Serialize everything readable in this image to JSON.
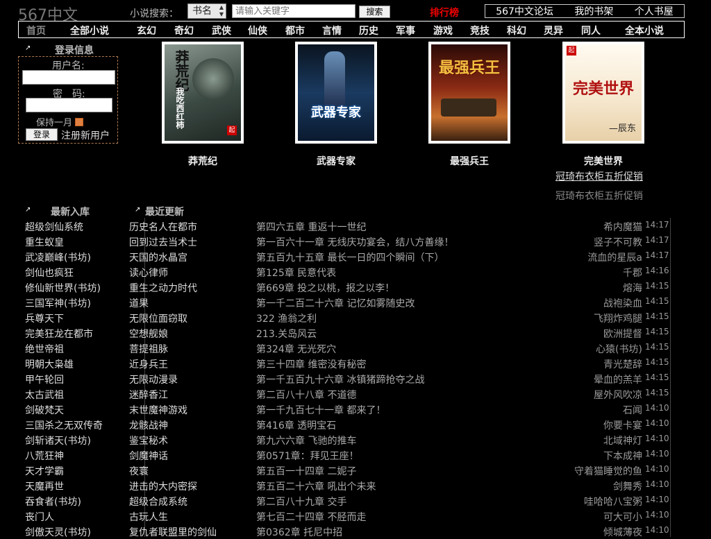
{
  "logo": "567中文",
  "search": {
    "label": "小说搜索：",
    "type": "书名",
    "placeholder": "请输入关键字",
    "button": "搜索"
  },
  "rank_link": "排行榜",
  "top_links": [
    "567中文论坛",
    "我的书架",
    "个人书屋"
  ],
  "nav": [
    "首页",
    "全部小说",
    "玄幻",
    "奇幻",
    "武侠",
    "仙侠",
    "都市",
    "言情",
    "历史",
    "军事",
    "游戏",
    "竞技",
    "科幻",
    "灵异",
    "同人",
    "全本小说"
  ],
  "login": {
    "title": "登录信息",
    "username_label": "用户名:",
    "password_label": "密　码:",
    "remember": "保持一月",
    "login_button": "登录",
    "register": "注册新用户"
  },
  "featured": [
    {
      "title": "莽荒纪",
      "cover_text": "莽荒纪",
      "author_text": "我吃西红柿",
      "colors": [
        "#2d3a34",
        "#6b7a70"
      ]
    },
    {
      "title": "武器专家",
      "cover_text": "武器专家",
      "author_text": "",
      "colors": [
        "#0c2a4a",
        "#3a6ea0"
      ]
    },
    {
      "title": "最强兵王",
      "cover_text": "最强兵王",
      "author_text": "",
      "colors": [
        "#5a1810",
        "#c06a30"
      ]
    },
    {
      "title": "完美世界",
      "cover_text": "完美世界",
      "author_text": "—辰东",
      "colors": [
        "#f5efe0",
        "#e8c8a0"
      ]
    }
  ],
  "promos": [
    "冠琦布衣柜五折促销",
    "冠琦布衣柜五折促销"
  ],
  "sections": {
    "latest": "最新入库",
    "updates": "最近更新"
  },
  "latest_books": [
    "超级剑仙系统",
    "重生蚁皇",
    "武凌巅峰(书坊)",
    "剑仙也疯狂",
    "修仙新世界(书坊)",
    "三国军神(书坊)",
    "兵尊天下",
    "完美狂龙在都市",
    "绝世帝祖",
    "明朝大枭雄",
    "甲午轮回",
    "太古武祖",
    "剑破梵天",
    "三国杀之无双传奇",
    "剑斩诸天(书坊)",
    "八荒狂神",
    "天才学霸",
    "天魔再世",
    "吞食者(书坊)",
    "丧门人",
    "剑傲天灵(书坊)"
  ],
  "updates": [
    {
      "title": "历史名人在都市",
      "chapter": "第四六五章 重返十一世纪",
      "author": "希内魔猫",
      "time": "14:17"
    },
    {
      "title": "回到过去当术士",
      "chapter": "第一百六十一章 无线庆功宴会，结八方善缘！",
      "author": "竖子不可教",
      "time": "14:17"
    },
    {
      "title": "天国的水晶宫",
      "chapter": "第五百九十五章 最长一日的四个瞬间（下）",
      "author": "流血的星辰a",
      "time": "14:17"
    },
    {
      "title": "读心律师",
      "chapter": "第125章 民意代表",
      "author": "千郡",
      "time": "14:16"
    },
    {
      "title": "重生之动力时代",
      "chapter": "第669章 投之以桃，报之以李！",
      "author": "熔海",
      "time": "14:15"
    },
    {
      "title": "道果",
      "chapter": "第一千二百二十六章 记忆如雾随史改",
      "author": "战袍染血",
      "time": "14:15"
    },
    {
      "title": "无限位面窃取",
      "chapter": "322 渔翁之利",
      "author": "飞翔炸鸡腿",
      "time": "14:15"
    },
    {
      "title": "空想舰娘",
      "chapter": "213.关岛风云",
      "author": "欧洲提督",
      "time": "14:15"
    },
    {
      "title": "菩提祖脉",
      "chapter": "第324章 无光死穴",
      "author": "心猿(书坊)",
      "time": "14:15"
    },
    {
      "title": "近身兵王",
      "chapter": "第三十四章 维密没有秘密",
      "author": "青光楚辞",
      "time": "14:15"
    },
    {
      "title": "无限动漫录",
      "chapter": "第一千五百九十六章 冰镇猪蹄抢夺之战",
      "author": "晕血的羔羊",
      "time": "14:15"
    },
    {
      "title": "迷醉香江",
      "chapter": "第二百八十八章 不道德",
      "author": "屋外风吹凉",
      "time": "14:15"
    },
    {
      "title": "末世魔神游戏",
      "chapter": "第一千九百七十一章 都来了！",
      "author": "石闻",
      "time": "14:10"
    },
    {
      "title": "龙骸战神",
      "chapter": "第416章 透明宝石",
      "author": "你要卡宴",
      "time": "14:10"
    },
    {
      "title": "鉴宝秘术",
      "chapter": "第九六六章 飞驰的推车",
      "author": "北域神灯",
      "time": "14:10"
    },
    {
      "title": "剑魔神话",
      "chapter": "第0571章：拜见王座！",
      "author": "下本成神",
      "time": "14:10"
    },
    {
      "title": "夜寰",
      "chapter": "第五百一十四章 二妮子",
      "author": "守着猫睡觉的鱼",
      "time": "14:10"
    },
    {
      "title": "进击的大内密探",
      "chapter": "第五百二十六章 吼出个未来",
      "author": "剑舞秀",
      "time": "14:10"
    },
    {
      "title": "超级合成系统",
      "chapter": "第二百八十九章 交手",
      "author": "哇哈哈八宝粥",
      "time": "14:10"
    },
    {
      "title": "古玩人生",
      "chapter": "第七百二十四章 不胫而走",
      "author": "可大可小",
      "time": "14:10"
    },
    {
      "title": "复仇者联盟里的剑仙",
      "chapter": "第0362章 托尼中招",
      "author": "倾城薄夜",
      "time": "14:10"
    }
  ]
}
